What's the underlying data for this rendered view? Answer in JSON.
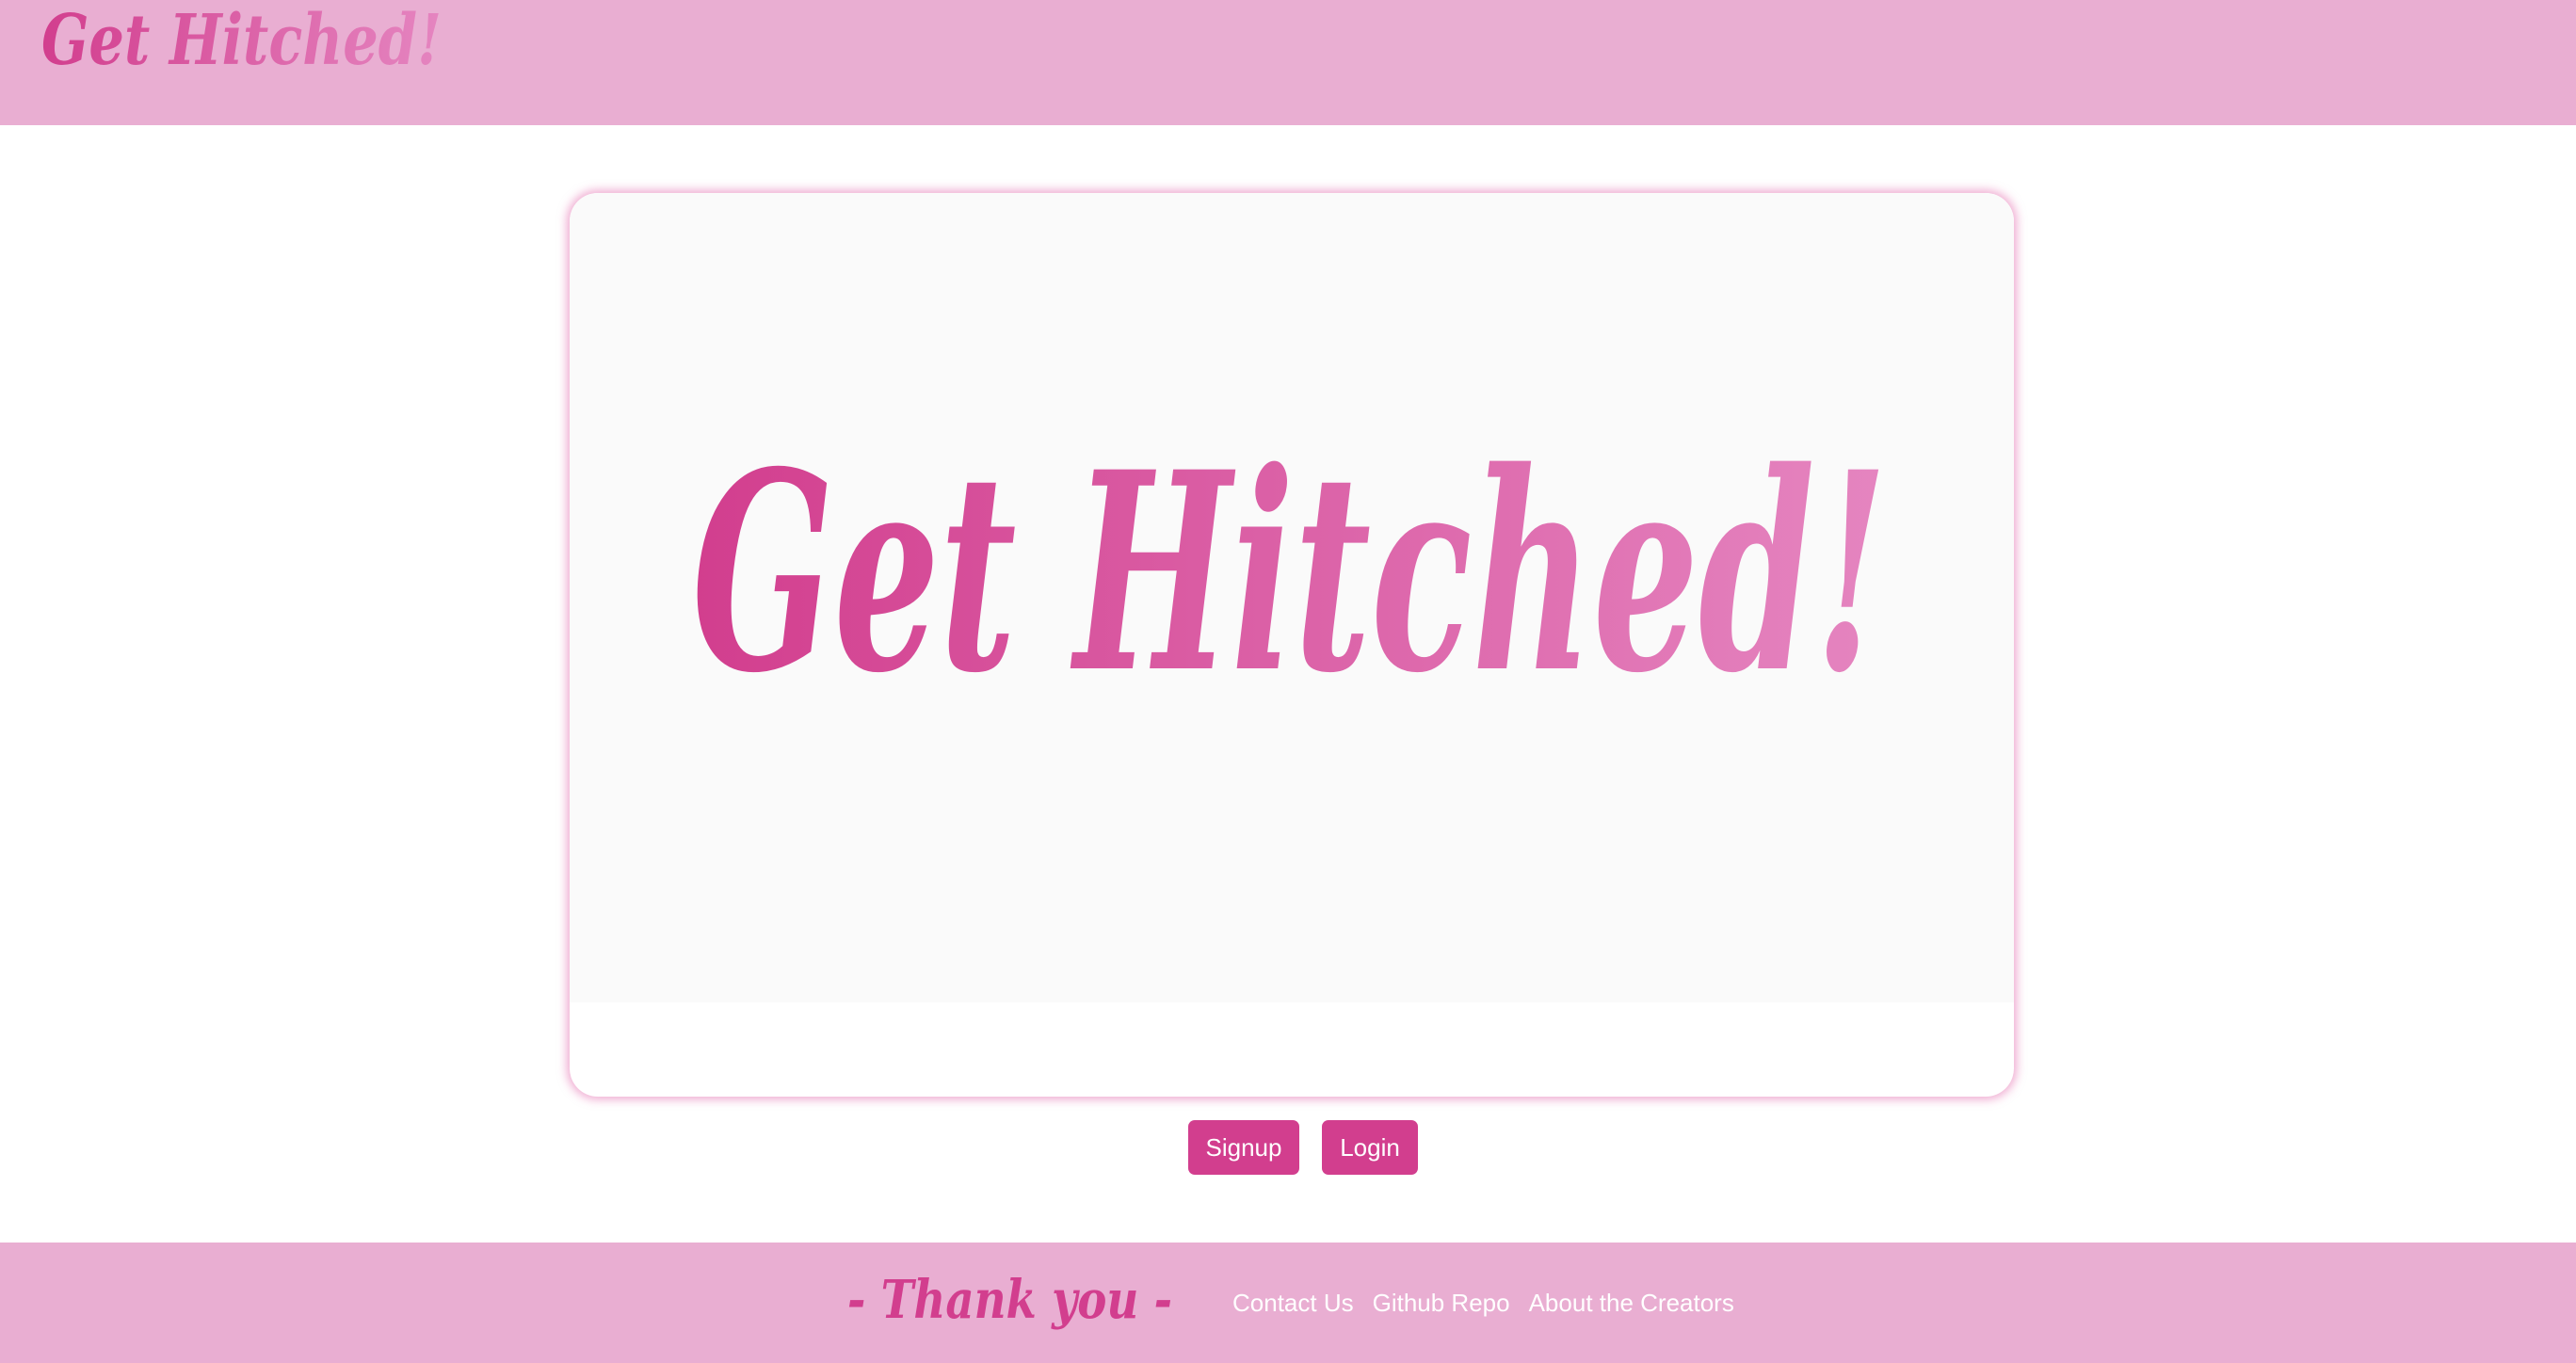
{
  "header": {
    "logo_text": "Get Hitched!"
  },
  "hero": {
    "image_text": "Get Hitched!"
  },
  "actions": {
    "signup_label": "Signup",
    "login_label": "Login"
  },
  "footer": {
    "thanks_text": "- Thank you -",
    "links": [
      {
        "label": "Contact Us"
      },
      {
        "label": "Github Repo"
      },
      {
        "label": "About the Creators"
      }
    ]
  },
  "colors": {
    "header_bg": "#e9aed2",
    "footer_bg": "#e9aed2",
    "accent": "#d23e8e",
    "logo_gradient_start": "#d23e8e",
    "logo_gradient_end": "#e585c0",
    "card_bg": "#fafafa"
  }
}
